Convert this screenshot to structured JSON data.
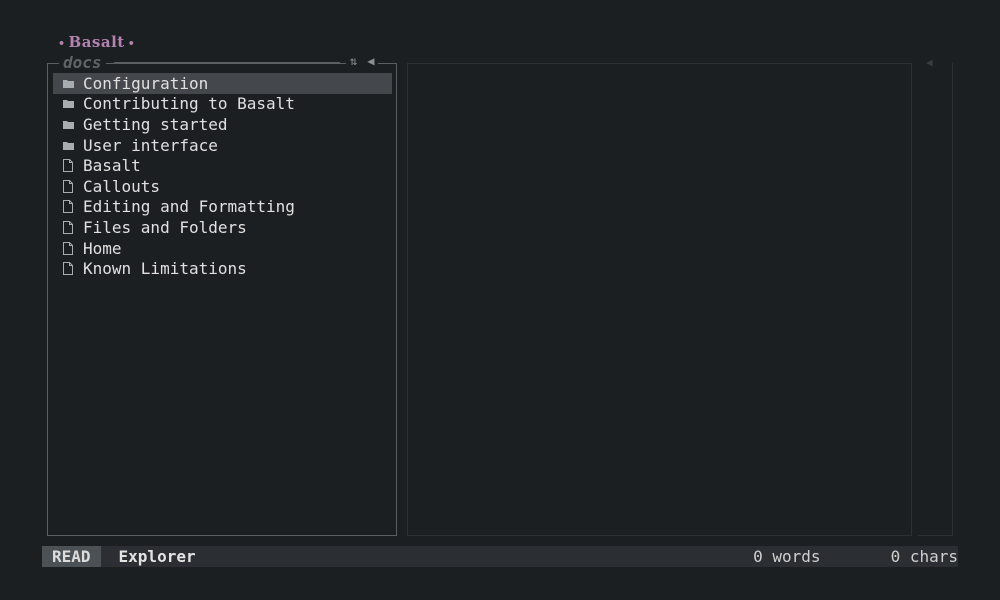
{
  "app": {
    "name": "Basalt"
  },
  "explorer": {
    "title": "docs",
    "sort_icon": "sort-icon",
    "collapse_icon": "collapse-left-icon",
    "items": [
      {
        "label": "Configuration",
        "type": "folder",
        "selected": true
      },
      {
        "label": "Contributing to Basalt",
        "type": "folder",
        "selected": false
      },
      {
        "label": "Getting started",
        "type": "folder",
        "selected": false
      },
      {
        "label": "User interface",
        "type": "folder",
        "selected": false
      },
      {
        "label": "Basalt",
        "type": "file",
        "selected": false
      },
      {
        "label": "Callouts",
        "type": "file",
        "selected": false
      },
      {
        "label": "Editing and Formatting",
        "type": "file",
        "selected": false
      },
      {
        "label": "Files and Folders",
        "type": "file",
        "selected": false
      },
      {
        "label": "Home",
        "type": "file",
        "selected": false
      },
      {
        "label": "Known Limitations",
        "type": "file",
        "selected": false
      }
    ]
  },
  "outline": {
    "toggle_icon": "collapse-left-icon"
  },
  "statusbar": {
    "mode": "READ",
    "pane": "Explorer",
    "words": "0 words",
    "chars": "0 chars"
  },
  "colors": {
    "background": "#1c1f22",
    "brand": "#b383b0",
    "selection": "#44484c",
    "statusbar": "#2b2f33",
    "mode_badge": "#4c5155",
    "border": "#5b5f63"
  }
}
